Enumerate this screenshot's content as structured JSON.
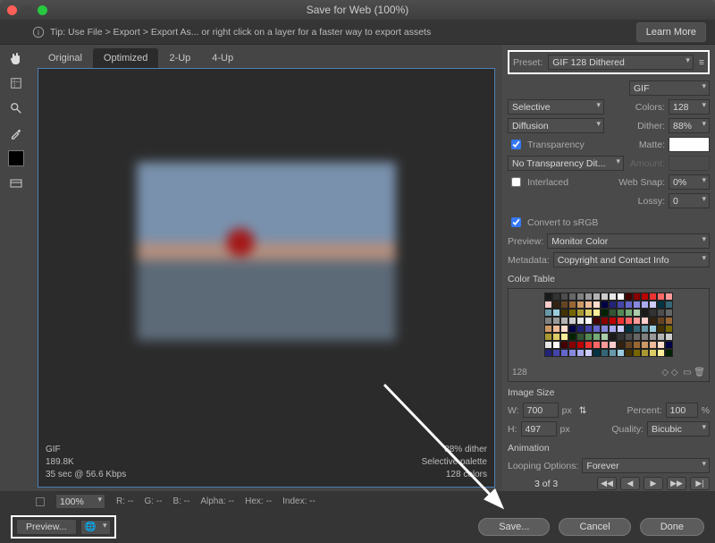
{
  "title": "Save for Web (100%)",
  "tip": {
    "text": "Tip: Use File > Export > Export As...  or right click on a layer for a faster way to export assets",
    "learn_more": "Learn More"
  },
  "tabs": {
    "original": "Original",
    "optimized": "Optimized",
    "two_up": "2-Up",
    "four_up": "4-Up"
  },
  "preview_meta": {
    "format": "GIF",
    "size": "189.8K",
    "time": "35 sec @ 56.6 Kbps",
    "dither": "88% dither",
    "palette": "Selective palette",
    "colors": "128 colors"
  },
  "preset": {
    "label": "Preset:",
    "value": "GIF 128 Dithered"
  },
  "gif": {
    "format": "GIF",
    "reduction": "Selective",
    "colors_label": "Colors:",
    "colors": "128",
    "dither_type": "Diffusion",
    "dither_label": "Dither:",
    "dither": "88%",
    "transparency": "Transparency",
    "matte_label": "Matte:",
    "trans_dither": "No Transparency Dit...",
    "amount_label": "Amount:",
    "interlaced": "Interlaced",
    "websnap_label": "Web Snap:",
    "websnap": "0%",
    "lossy_label": "Lossy:",
    "lossy": "0",
    "srgb": "Convert to sRGB",
    "preview_label": "Preview:",
    "preview": "Monitor Color",
    "metadata_label": "Metadata:",
    "metadata": "Copyright and Contact Info"
  },
  "colortable": {
    "label": "Color Table",
    "count": "128"
  },
  "imagesize": {
    "label": "Image Size",
    "w_label": "W:",
    "w": "700",
    "h_label": "H:",
    "h": "497",
    "px": "px",
    "percent_label": "Percent:",
    "percent": "100",
    "pct": "%",
    "quality_label": "Quality:",
    "quality": "Bicubic"
  },
  "animation": {
    "label": "Animation",
    "looping_label": "Looping Options:",
    "looping": "Forever",
    "frame": "3 of 3"
  },
  "footer": {
    "zoom": "100%",
    "r": "R: --",
    "g": "G: --",
    "b": "B: --",
    "alpha": "Alpha: --",
    "hex": "Hex: --",
    "index": "Index: --"
  },
  "buttons": {
    "preview": "Preview...",
    "save": "Save...",
    "cancel": "Cancel",
    "done": "Done"
  }
}
